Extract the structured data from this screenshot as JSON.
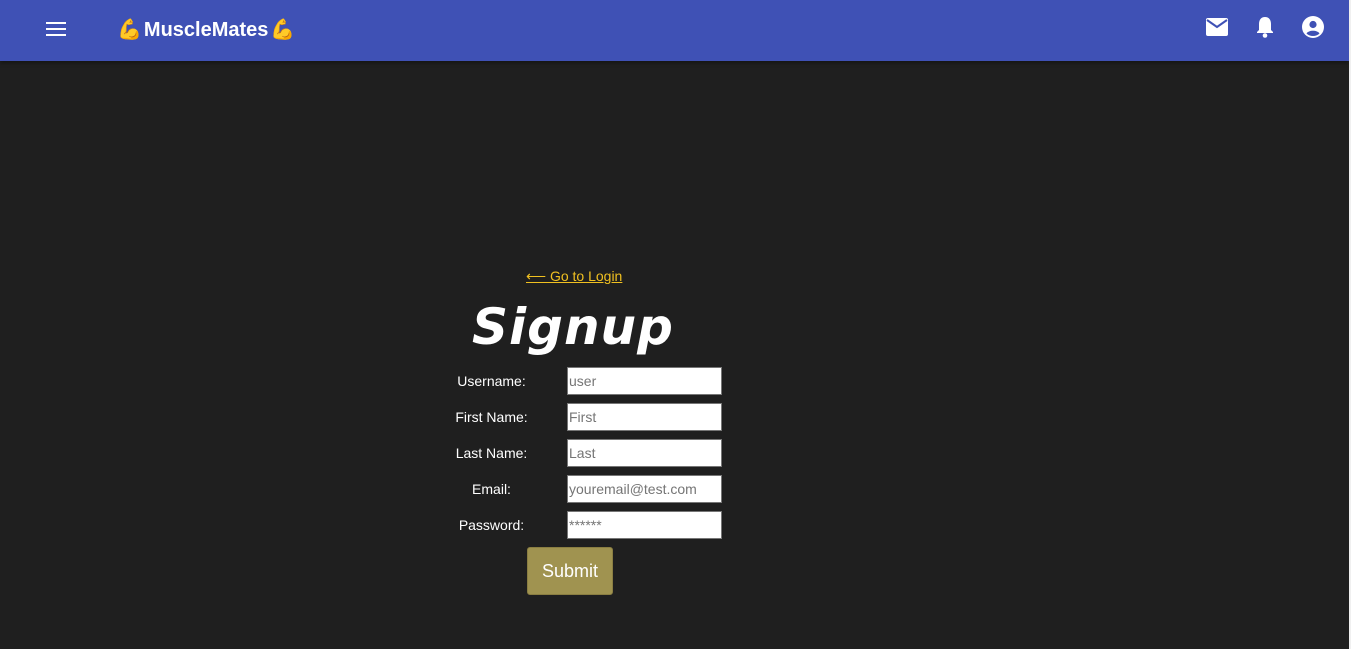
{
  "header": {
    "brand_title": "MuscleMates",
    "brand_emoji_left": "💪",
    "brand_emoji_right": "💪",
    "icons": [
      "menu-icon",
      "mail-icon",
      "bell-icon",
      "account-circle-icon"
    ]
  },
  "colors": {
    "appbar": "#3f51b5",
    "background": "#1f1f1f",
    "link": "#f0c020",
    "submit": "#a09350"
  },
  "signup": {
    "back_link": "⟵ Go to Login",
    "title": "Signup",
    "fields": [
      {
        "label": "Username:",
        "placeholder": "user"
      },
      {
        "label": "First Name:",
        "placeholder": "First"
      },
      {
        "label": "Last Name:",
        "placeholder": "Last"
      },
      {
        "label": "Email:",
        "placeholder": "youremail@test.com"
      },
      {
        "label": "Password:",
        "placeholder": "******"
      }
    ],
    "submit_label": "Submit"
  }
}
